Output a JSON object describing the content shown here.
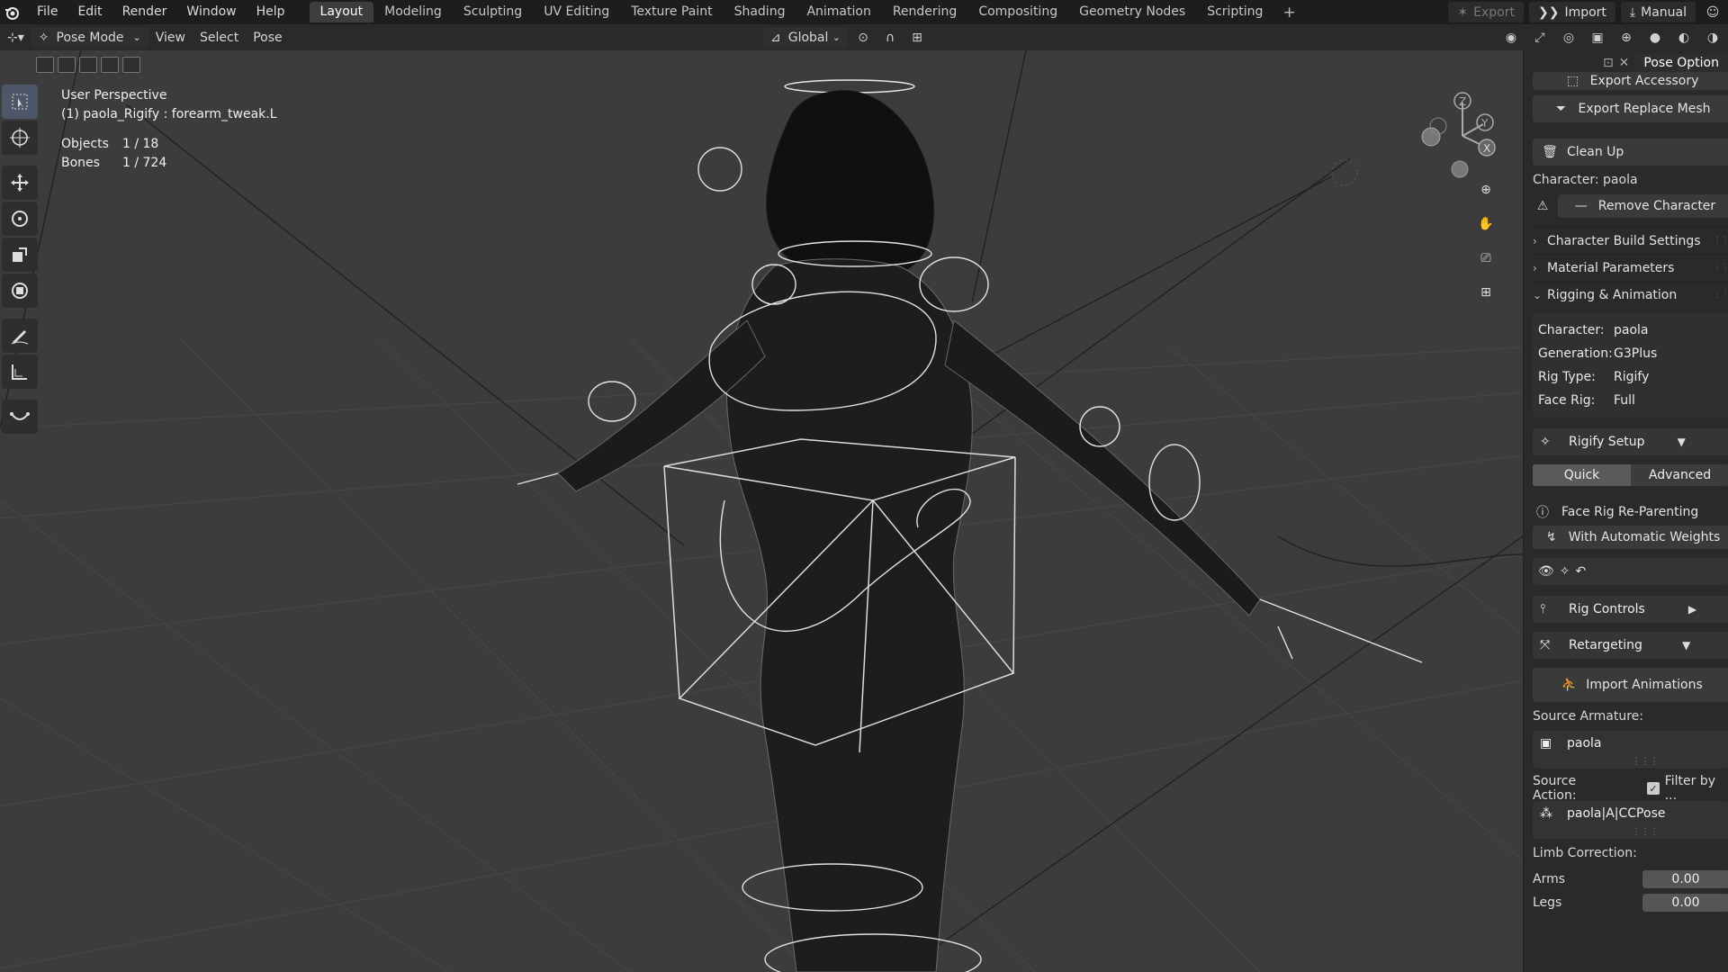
{
  "menu": {
    "items": [
      "File",
      "Edit",
      "Render",
      "Window",
      "Help"
    ]
  },
  "workspaces": {
    "tabs": [
      "Layout",
      "Modeling",
      "Sculpting",
      "UV Editing",
      "Texture Paint",
      "Shading",
      "Animation",
      "Rendering",
      "Compositing",
      "Geometry Nodes",
      "Scripting"
    ],
    "active": "Layout",
    "add_label": "+"
  },
  "top_right": {
    "export_label": "Export",
    "import_label": "Import",
    "manual_label": "Manual"
  },
  "header": {
    "mode": "Pose Mode",
    "menus": [
      "View",
      "Select",
      "Pose"
    ],
    "orientation": "Global"
  },
  "viewport": {
    "perspective": "User Perspective",
    "active_object": "(1) paola_Rigify : forearm_tweak.L",
    "objects_label": "Objects",
    "objects_value": "1 / 18",
    "bones_label": "Bones",
    "bones_value": "1 / 724",
    "gizmo_axes": [
      "Z",
      "Y",
      "X"
    ]
  },
  "npanel": {
    "tab_name": "Pose Option",
    "export_accessory": "Export Accessory",
    "export_replace_mesh": "Export Replace Mesh",
    "clean_up": "Clean Up",
    "character_label": "Character: paola",
    "remove_character": "Remove Character",
    "sections": {
      "build": "Character Build Settings",
      "material": "Material Parameters",
      "rigging": "Rigging & Animation"
    },
    "info": {
      "character_k": "Character:",
      "character_v": "paola",
      "generation_k": "Generation:",
      "generation_v": "G3Plus",
      "rigtype_k": "Rig Type:",
      "rigtype_v": "Rigify",
      "facerig_k": "Face Rig:",
      "facerig_v": "Full"
    },
    "rigify_setup": "Rigify Setup",
    "quick": "Quick",
    "advanced": "Advanced",
    "face_rig_reparenting": "Face Rig Re-Parenting",
    "with_automatic_weights": "With Automatic Weights",
    "rig_controls": "Rig Controls",
    "retargeting": "Retargeting",
    "import_animations": "Import Animations",
    "source_armature_label": "Source Armature:",
    "source_armature_value": "paola",
    "source_action_label": "Source Action:",
    "filter_by": "Filter by ...",
    "source_action_value": "paola|A|CCPose",
    "limb_correction_label": "Limb Correction:",
    "arms_label": "Arms",
    "arms_value": "0.00",
    "legs_label": "Legs",
    "legs_value": "0.00"
  }
}
